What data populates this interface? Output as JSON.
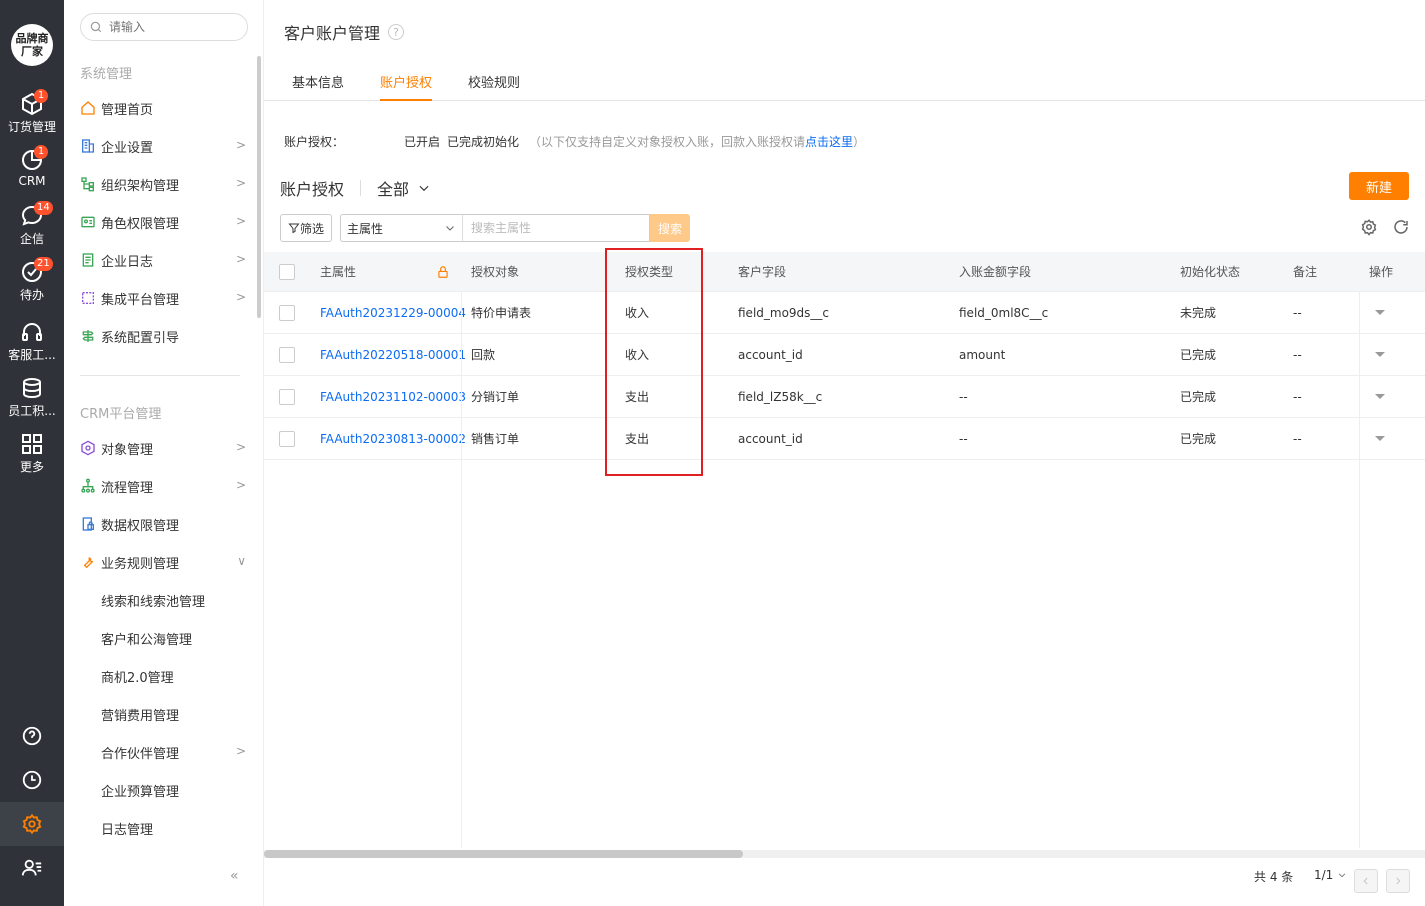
{
  "rail": {
    "avatar_text": "品牌商厂家",
    "items": [
      {
        "label": "订货管理",
        "badge": "1",
        "icon": "cube-icon"
      },
      {
        "label": "CRM",
        "badge": "1",
        "icon": "pie-chart-icon"
      },
      {
        "label": "企信",
        "badge": "14",
        "icon": "chat-bubble-icon"
      },
      {
        "label": "待办",
        "badge": "21",
        "icon": "check-circle-icon"
      },
      {
        "label": "客服工...",
        "badge": "",
        "icon": "headset-icon"
      },
      {
        "label": "员工积...",
        "badge": "",
        "icon": "database-icon"
      },
      {
        "label": "更多",
        "badge": "",
        "icon": "grid-icon"
      }
    ],
    "bottom_icons": [
      "help-icon",
      "clock-icon",
      "settings-icon",
      "user-manage-icon"
    ]
  },
  "sidebar": {
    "search_placeholder": "请输入",
    "group1": "系统管理",
    "group1_items": [
      {
        "label": "管理首页",
        "icon": "home-icon",
        "chevron": false
      },
      {
        "label": "企业设置",
        "icon": "building-icon",
        "chevron": true
      },
      {
        "label": "组织架构管理",
        "icon": "org-tree-icon",
        "chevron": true
      },
      {
        "label": "角色权限管理",
        "icon": "role-card-icon",
        "chevron": true
      },
      {
        "label": "企业日志",
        "icon": "log-icon",
        "chevron": true
      },
      {
        "label": "集成平台管理",
        "icon": "integration-icon",
        "chevron": true
      },
      {
        "label": "系统配置引导",
        "icon": "guide-icon",
        "chevron": false
      }
    ],
    "group2": "CRM平台管理",
    "group2_items": [
      {
        "label": "对象管理",
        "icon": "object-icon",
        "chevron": true
      },
      {
        "label": "流程管理",
        "icon": "flow-icon",
        "chevron": true
      },
      {
        "label": "数据权限管理",
        "icon": "data-lock-icon",
        "chevron": false
      },
      {
        "label": "业务规则管理",
        "icon": "wrench-icon",
        "chevron": true
      }
    ],
    "sub_items": [
      {
        "label": "线索和线索池管理",
        "chevron": false
      },
      {
        "label": "客户和公海管理",
        "chevron": false
      },
      {
        "label": "商机2.0管理",
        "chevron": false
      },
      {
        "label": "营销费用管理",
        "chevron": false
      },
      {
        "label": "合作伙伴管理",
        "chevron": true
      },
      {
        "label": "企业预算管理",
        "chevron": false
      },
      {
        "label": "日志管理",
        "chevron": false
      }
    ],
    "collapse_symbol": "«"
  },
  "page": {
    "title": "客户账户管理",
    "help": "?",
    "tabs": [
      "基本信息",
      "账户授权",
      "校验规则"
    ],
    "active_tab": 1,
    "auth_label": "账户授权：",
    "auth_status1": "已开启",
    "auth_status2": "已完成初始化",
    "auth_note_prefix": "（以下仅支持自定义对象授权入账，回款入账授权请",
    "auth_note_link": "点击这里",
    "auth_note_suffix": "）",
    "list_title": "账户授权",
    "scope": "全部",
    "new_button": "新建",
    "filter_button": "筛选",
    "field_select": "主属性",
    "search_placeholder": "搜索主属性",
    "search_button": "搜索"
  },
  "table": {
    "headers": [
      "主属性",
      "授权对象",
      "授权类型",
      "客户字段",
      "入账金额字段",
      "初始化状态",
      "备注",
      "操作"
    ],
    "rows": [
      [
        "FAAuth20231229-00004",
        "特价申请表",
        "收入",
        "field_mo9ds__c",
        "field_0ml8C__c",
        "未完成",
        "--"
      ],
      [
        "FAAuth20220518-00001",
        "回款",
        "收入",
        "account_id",
        "amount",
        "已完成",
        "--"
      ],
      [
        "FAAuth20231102-00003",
        "分销订单",
        "支出",
        "field_lZ58k__c",
        "--",
        "已完成",
        "--"
      ],
      [
        "FAAuth20230813-00002",
        "销售订单",
        "支出",
        "account_id",
        "--",
        "已完成",
        "--"
      ]
    ]
  },
  "pager": {
    "total": "共 4 条",
    "page": "1/1"
  },
  "colors": {
    "accent": "#ff8000",
    "link": "#0c6cf2",
    "highlight": "#e02020",
    "rail": "#2f3238"
  }
}
